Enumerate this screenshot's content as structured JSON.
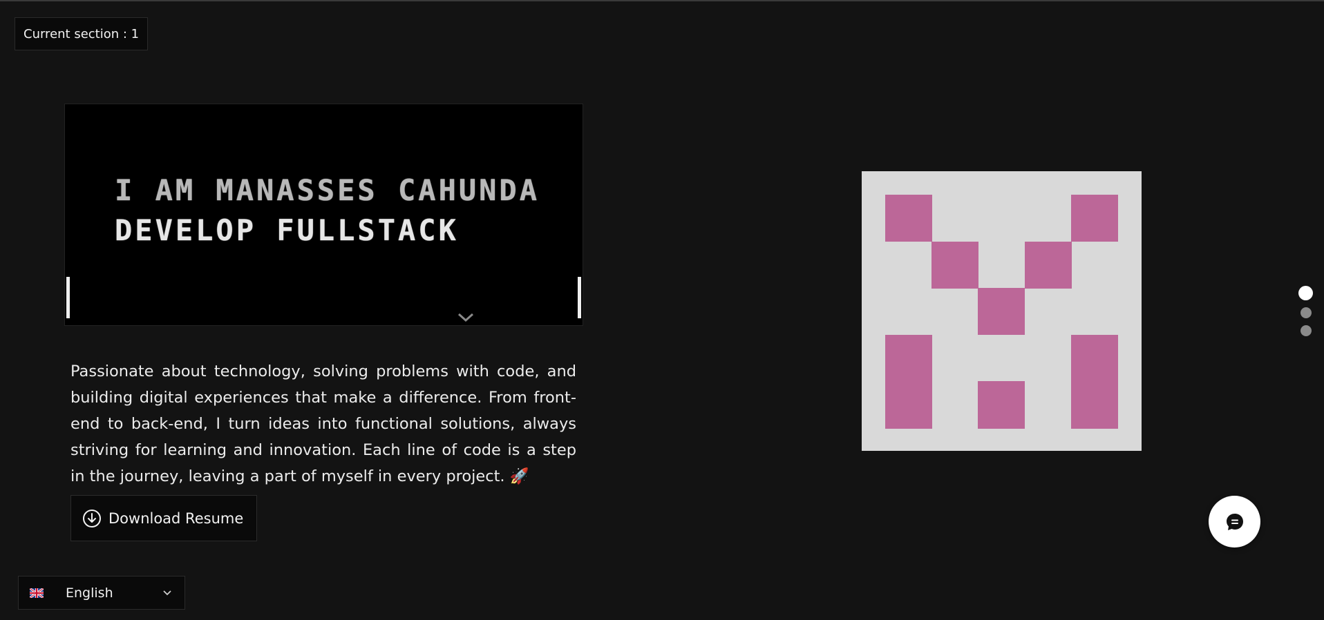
{
  "section_indicator": {
    "label": "Current section : 1"
  },
  "hero": {
    "line1": "I AM MANASSES CAHUNDA",
    "line2": "DEVELOP FULLSTACK"
  },
  "description": "Passionate about technology, solving problems with code, and building digital experiences that make a difference. From front-end to back-end, I turn ideas into functional solutions, always striving for learning and innovation. Each line of code is a step in the journey, leaving a part of myself in every project. 🚀",
  "download": {
    "label": "Download Resume",
    "icon": "download-circle-icon"
  },
  "section_nav": {
    "count": 3,
    "active_index": 0
  },
  "chat": {
    "icon": "chat-bubble-icon"
  },
  "language": {
    "selected": "English",
    "flag": "uk-flag-icon"
  },
  "colors": {
    "background": "#131313",
    "logo_background": "#d9d9d9",
    "logo_pink": "#bc6798"
  }
}
